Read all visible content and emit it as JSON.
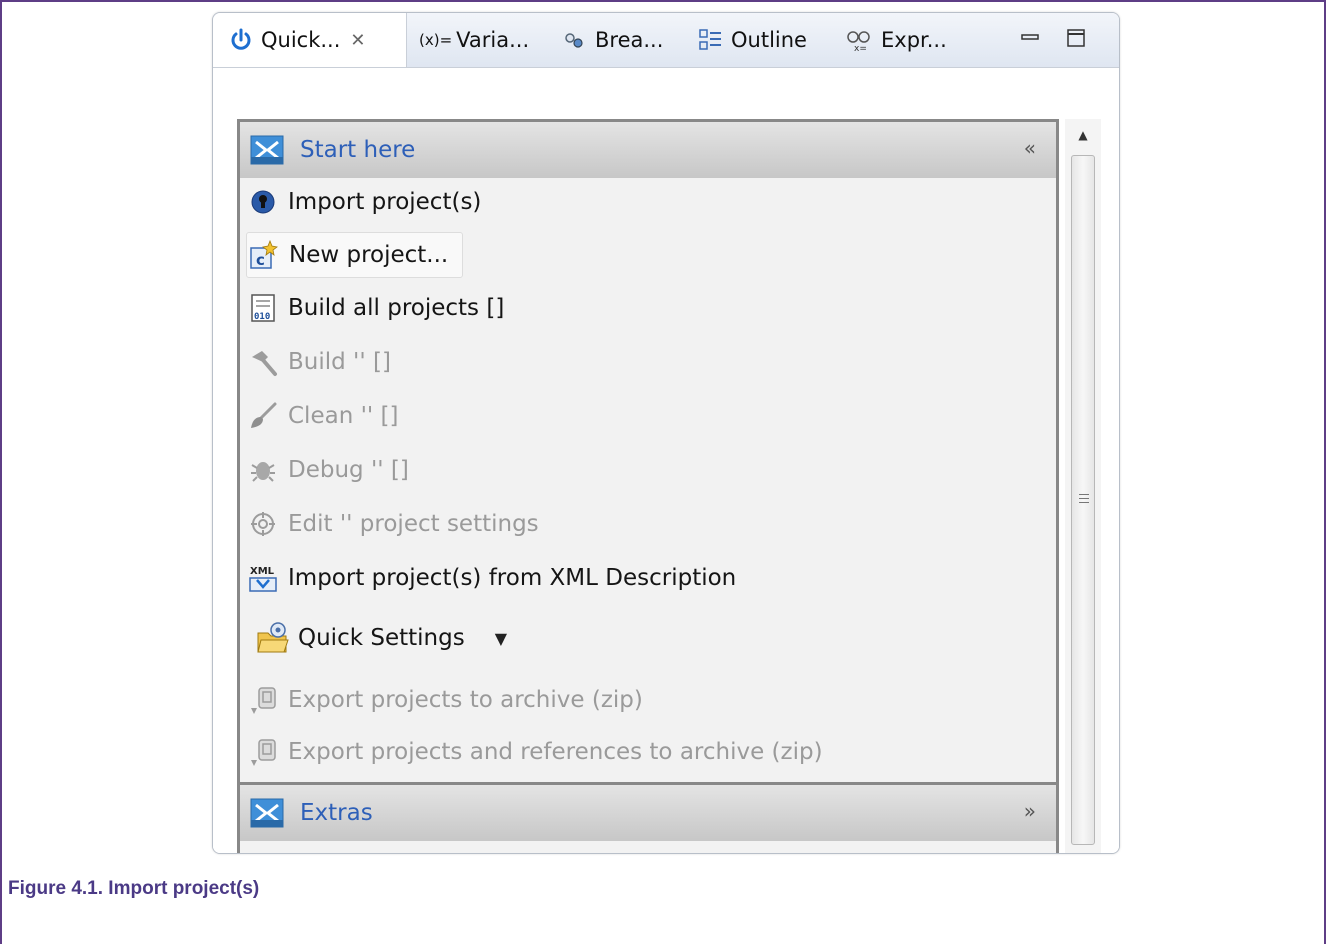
{
  "tabs": [
    {
      "label": "Quick...",
      "icon": "power-icon",
      "active": true
    },
    {
      "label": "Varia...",
      "icon": "variables-icon",
      "prefix": "(x)="
    },
    {
      "label": "Brea...",
      "icon": "breakpoints-icon"
    },
    {
      "label": "Outline",
      "icon": "outline-icon"
    },
    {
      "label": "Expr...",
      "icon": "expressions-icon"
    }
  ],
  "sections": {
    "start": {
      "title": "Start here",
      "chevron": "«"
    },
    "extras": {
      "title": "Extras",
      "chevron": "»"
    }
  },
  "items": [
    {
      "label": "Import project(s)",
      "icon": "import-bulb-icon",
      "enabled": true
    },
    {
      "label": "New project...",
      "icon": "new-c-project-icon",
      "enabled": true
    },
    {
      "label": "Build all projects []",
      "icon": "build-all-icon",
      "enabled": true
    },
    {
      "label": "Build '' []",
      "icon": "hammer-icon",
      "enabled": false
    },
    {
      "label": "Clean '' []",
      "icon": "brush-icon",
      "enabled": false
    },
    {
      "label": "Debug '' []",
      "icon": "debug-bug-icon",
      "enabled": false
    },
    {
      "label": "Edit '' project settings",
      "icon": "settings-gear-icon",
      "enabled": false
    },
    {
      "label": "Import project(s) from XML Description",
      "icon": "xml-import-icon",
      "enabled": true
    },
    {
      "label": "Quick Settings",
      "icon": "folder-settings-icon",
      "enabled": true
    },
    {
      "label": "Export projects to archive (zip)",
      "icon": "export-archive-icon",
      "enabled": false
    },
    {
      "label": "Export projects and references to archive (zip)",
      "icon": "export-archive-icon",
      "enabled": false
    }
  ],
  "colors": {
    "frame": "#5e3d86",
    "link": "#2d5fb8",
    "caption": "#4b3a86",
    "disabled": "#9a9a9a"
  },
  "caption": "Figure 4.1. Import project(s)"
}
